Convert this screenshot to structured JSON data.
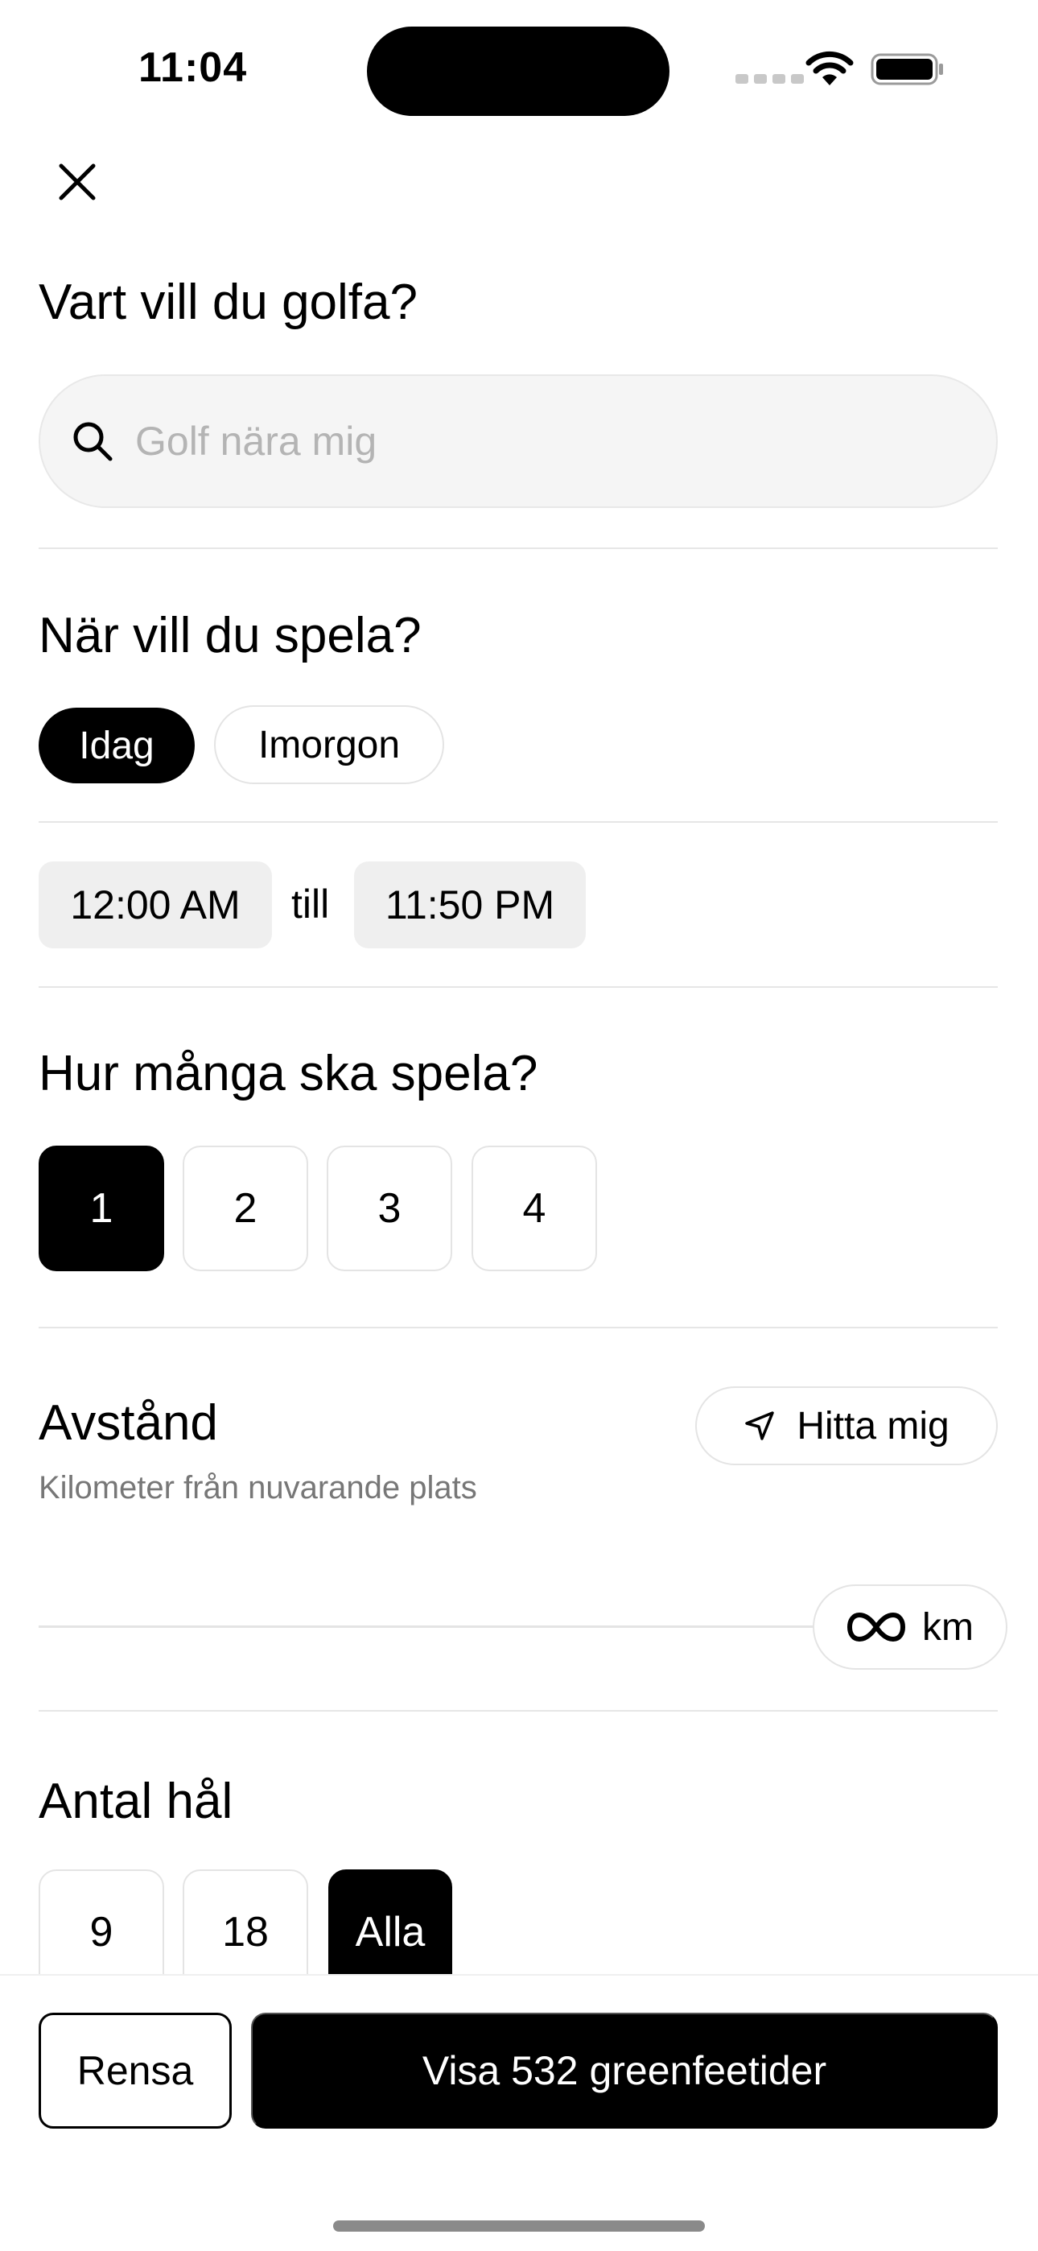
{
  "status_bar": {
    "time": "11:04"
  },
  "location": {
    "heading": "Vart vill du golfa?",
    "search_placeholder": "Golf nära mig",
    "search_value": ""
  },
  "when": {
    "heading": "När vill du spela?",
    "day_options": [
      {
        "label": "Idag",
        "selected": true
      },
      {
        "label": "Imorgon",
        "selected": false
      }
    ],
    "start_time": "12:00 AM",
    "separator": "till",
    "end_time": "11:50 PM"
  },
  "players": {
    "heading": "Hur många ska spela?",
    "options": [
      "1",
      "2",
      "3",
      "4"
    ],
    "selected": "1"
  },
  "distance": {
    "heading": "Avstånd",
    "subtext": "Kilometer från nuvarande plats",
    "find_me_label": "Hitta mig",
    "unit": "km",
    "value": "infinity"
  },
  "holes": {
    "heading": "Antal hål",
    "options": [
      "9",
      "18",
      "Alla"
    ],
    "selected": "Alla"
  },
  "footer": {
    "clear_label": "Rensa",
    "show_label": "Visa 532 greenfeetider"
  },
  "colors": {
    "primary": "#000000",
    "chip_bg": "#efefef",
    "border": "#e4e4e4",
    "muted_text": "#777777"
  }
}
